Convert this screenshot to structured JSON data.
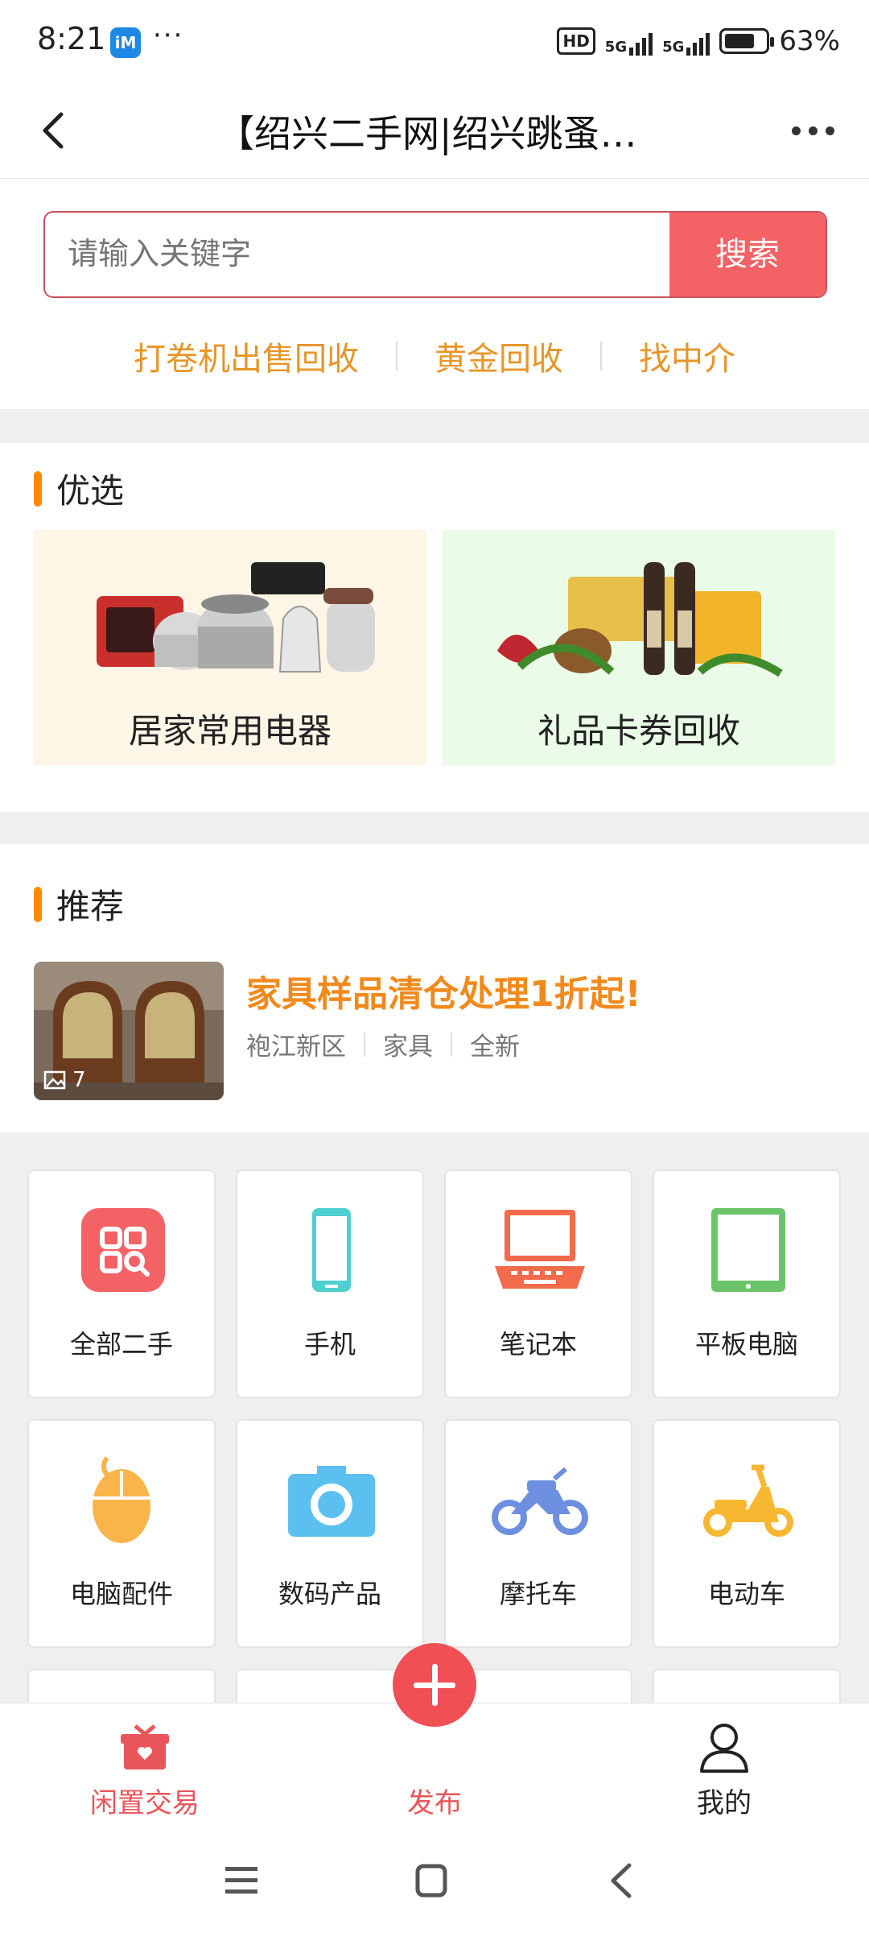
{
  "status_bar": {
    "time": "8:21",
    "app_badge": "iM",
    "notification_dots": "···",
    "hd": "HD",
    "network_1": "5G",
    "network_2": "5G",
    "battery": "63%"
  },
  "nav": {
    "title": "【绍兴二手网|绍兴跳蚤市…",
    "back_icon": "back-arrow-icon",
    "more_icon": "more-dots-icon"
  },
  "search": {
    "placeholder": "请输入关键字",
    "button": "搜索",
    "hot_links": [
      "打卷机出售回收",
      "黄金回收",
      "找中介"
    ]
  },
  "featured": {
    "title": "优选",
    "cards": [
      {
        "label": "居家常用电器",
        "bg": "#fdf5e6"
      },
      {
        "label": "礼品卡券回收",
        "bg": "#eafbe8"
      }
    ]
  },
  "recommend": {
    "title": "推荐",
    "item": {
      "title": "家具样品清仓处理1折起!",
      "location": "袍江新区",
      "category": "家具",
      "condition": "全新",
      "image_count": "7"
    }
  },
  "categories": [
    {
      "label": "全部二手",
      "icon": "grid-search-icon",
      "color": "#f36265"
    },
    {
      "label": "手机",
      "icon": "phone-icon",
      "color": "#4fcfcf"
    },
    {
      "label": "笔记本",
      "icon": "laptop-icon",
      "color": "#f26b4b"
    },
    {
      "label": "平板电脑",
      "icon": "tablet-icon",
      "color": "#6cc46a"
    },
    {
      "label": "电脑配件",
      "icon": "mouse-icon",
      "color": "#f9b54a"
    },
    {
      "label": "数码产品",
      "icon": "camera-icon",
      "color": "#5bc0ef"
    },
    {
      "label": "摩托车",
      "icon": "motorcycle-icon",
      "color": "#6d8fe0"
    },
    {
      "label": "电动车",
      "icon": "scooter-icon",
      "color": "#f7b731"
    }
  ],
  "tabbar": {
    "tabs": [
      {
        "label": "闲置交易",
        "icon": "gift-box-icon",
        "color": "#e8565b"
      },
      {
        "label": "发布",
        "icon": "plus-icon",
        "color": "#e8565b"
      },
      {
        "label": "我的",
        "icon": "user-icon",
        "color": "#222222"
      }
    ]
  },
  "system_nav": {
    "menu_icon": "menu-icon",
    "home_icon": "home-icon",
    "back_icon": "back-icon"
  },
  "colors": {
    "accent": "#f36265",
    "orange": "#f08a1c",
    "hot_link": "#e6962a",
    "section_bar": "#ff8a00"
  }
}
